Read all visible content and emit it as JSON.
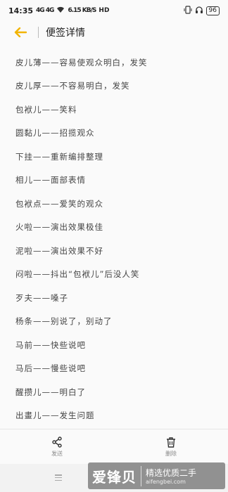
{
  "status": {
    "time": "14:35",
    "signal": "4G 4G",
    "speed": "6.15 KB/S",
    "hd": "HD",
    "battery": "96"
  },
  "header": {
    "title": "便签详情"
  },
  "note": {
    "lines": [
      "皮儿薄——容易使观众明白，发笑",
      "皮儿厚——不容易明白，发笑",
      "包袱儿——笑料",
      "圆黏儿——招揽观众",
      "下挂——重新编排整理",
      "相儿——面部表情",
      "包袱点——爱笑的观众",
      "火啦——演出效果极佳",
      "泥啦——演出效果不好",
      "闷啦——抖出“包袱儿”后没人笑",
      "歹夫——嗓子",
      "杨条——别说了，别动了",
      "马前——快些说吧",
      "马后——慢些说吧",
      "醒攒儿——明白了",
      "出畫儿——发生问题"
    ]
  },
  "toolbar": {
    "share_label": "发送",
    "delete_label": "删除"
  },
  "watermark": {
    "logo": "爱锋贝",
    "slogan": "精选优质二手",
    "url": "aifengbei.com"
  },
  "colors": {
    "accent": "#f2b400"
  }
}
